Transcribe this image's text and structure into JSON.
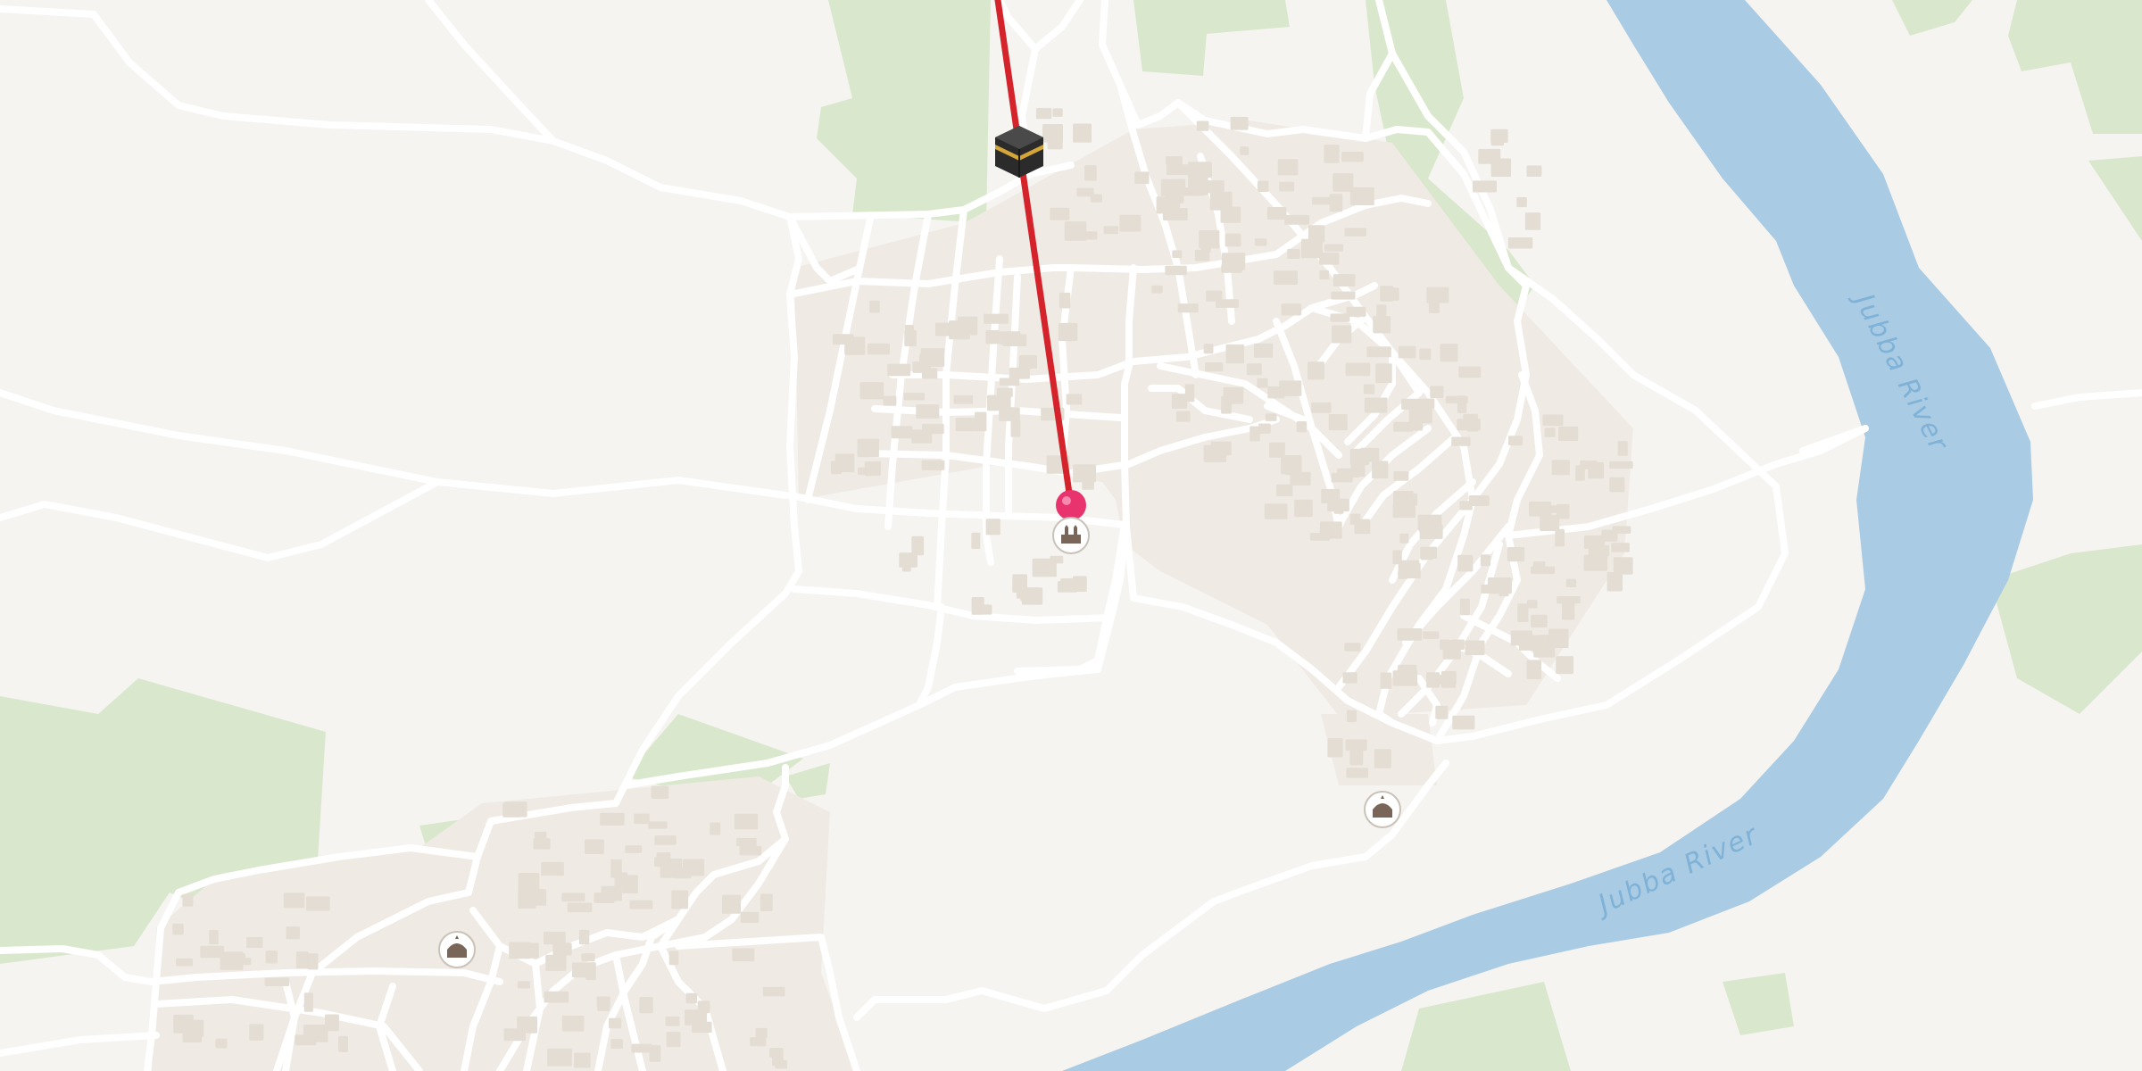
{
  "map": {
    "river_labels": [
      "Jubba River",
      "Jubba River"
    ],
    "colors": {
      "land": "#f6f4f1",
      "urban": "#efeae4",
      "vegetation": "#d9e8cd",
      "river": "#a9cbe3",
      "road": "#ffffff",
      "building": "#e4ddd4",
      "route_line": "#d4232b",
      "pin": "#e8336e"
    },
    "icons": {
      "qibla_marker": "kaaba-icon",
      "location_pin": "location-pin-icon",
      "places_of_worship": [
        "mosque-icon",
        "mosque-icon",
        "mosque-icon"
      ]
    }
  }
}
